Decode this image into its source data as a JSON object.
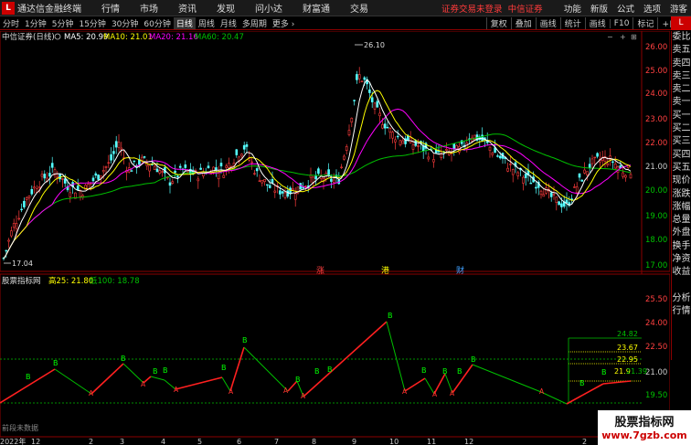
{
  "menubar": {
    "app_title": "通达信金融终端",
    "items": [
      "行情",
      "市场",
      "资讯",
      "发现",
      "问小达",
      "财富通",
      "交易"
    ],
    "login_status": "证券交易未登录",
    "broker": "中信证券",
    "right": [
      "功能",
      "新版",
      "公式",
      "选项",
      "游客"
    ]
  },
  "toolbar": {
    "periods": [
      "分时",
      "1分钟",
      "5分钟",
      "15分钟",
      "30分钟",
      "60分钟",
      "日线",
      "周线",
      "月线",
      "多周期",
      "更多"
    ],
    "active_period": "日线",
    "right": [
      "复权",
      "叠加",
      "画线",
      "统计",
      "画线",
      "F10",
      "标记",
      "+自选"
    ]
  },
  "side_marker": "L",
  "main_chart": {
    "title": "中信证券(日线)",
    "ma5": "MA5: 20.99",
    "ma10": "MA10: 21.01",
    "ma20": "MA20: 21.16",
    "ma60": "MA60: 20.47",
    "high_label": "26.10",
    "low_label": "17.04",
    "y_ticks": [
      "26.00",
      "25.00",
      "24.00",
      "23.00",
      "22.00",
      "21.00",
      "20.00",
      "19.00",
      "18.00",
      "17.00"
    ],
    "events": [
      "涨",
      "港",
      "财"
    ]
  },
  "sub_chart": {
    "title": "股票指标网",
    "label1": "高25: 21.80",
    "label2": "低100: 18.78",
    "y_ticks": [
      "25.50",
      "24.00",
      "22.50",
      "21.00",
      "19.50"
    ],
    "fib_levels": [
      "24.82",
      "23.67",
      "22.95",
      "21.9",
      "21.39"
    ],
    "no_data_note": "前段未数据"
  },
  "x_axis": {
    "year": "2022年",
    "months": [
      "12",
      "2",
      "3",
      "4",
      "5",
      "6",
      "7",
      "8",
      "9",
      "10",
      "11",
      "12",
      "2"
    ]
  },
  "side_tabs": [
    "委比",
    "卖五",
    "卖四",
    "卖三",
    "卖二",
    "卖一",
    "买一",
    "买二",
    "买三",
    "买四",
    "买五",
    "现价",
    "涨跌",
    "涨幅",
    "总量",
    "外盘",
    "换手",
    "净资",
    "收益",
    "",
    "分析",
    "行情"
  ],
  "watermark": {
    "line1": "股票指标网",
    "line2": "www.7gzb.com"
  },
  "colors": {
    "up": "#ff3c3c",
    "down": "#54ffff",
    "ma5": "#ffffff",
    "ma10": "#ffff00",
    "ma20": "#ff00ff",
    "ma60": "#00c000",
    "zigzag_up": "#ff2020",
    "zigzag_down": "#00c000"
  }
}
